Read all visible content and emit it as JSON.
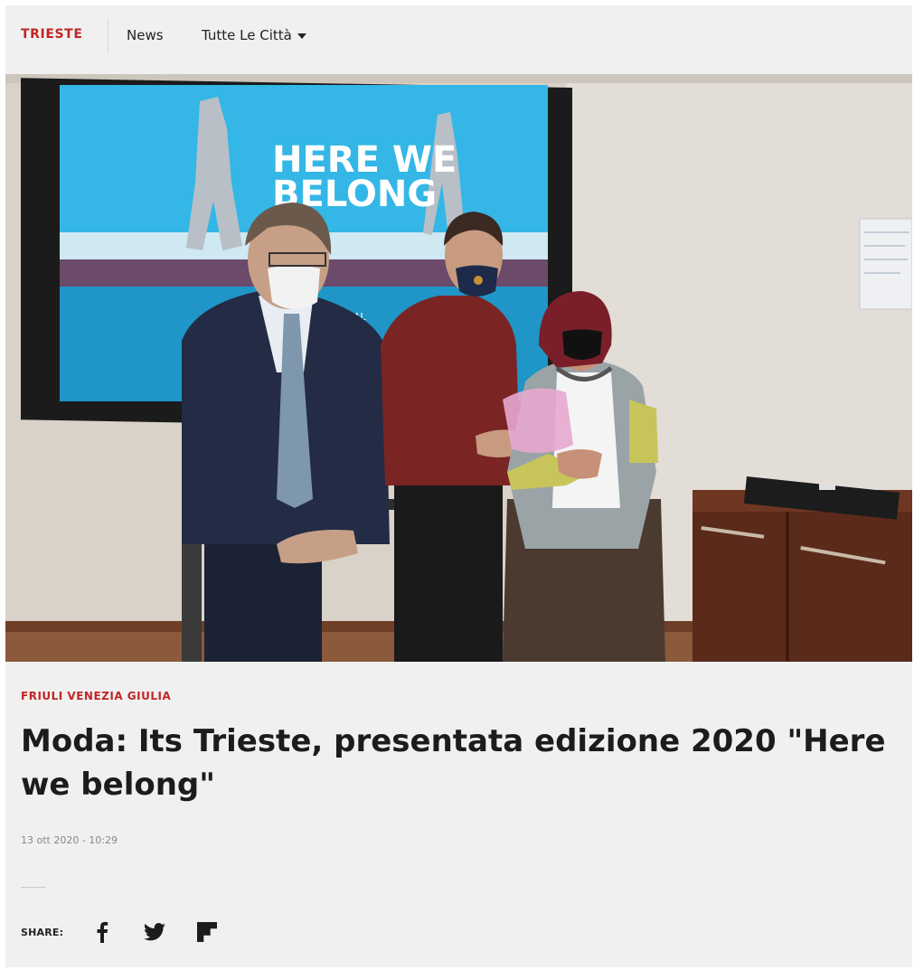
{
  "nav": {
    "city": "TRIESTE",
    "news": "News",
    "all_cities": "Tutte Le Città"
  },
  "photo": {
    "screen_text_line1": "HERE WE",
    "screen_text_line2": "BELONG",
    "screen_text_small": "ONAL"
  },
  "article": {
    "kicker": "FRIULI VENEZIA GIULIA",
    "headline": "Moda: Its Trieste, presentata edizione 2020 \"Here we belong\"",
    "date": "13 ott 2020 - 10:29"
  },
  "share": {
    "label": "SHARE:",
    "icons": [
      "facebook-icon",
      "twitter-icon",
      "flipboard-icon"
    ]
  },
  "colors": {
    "accent": "#c02626",
    "background": "#f0f0f0",
    "text": "#1c1c1c"
  }
}
